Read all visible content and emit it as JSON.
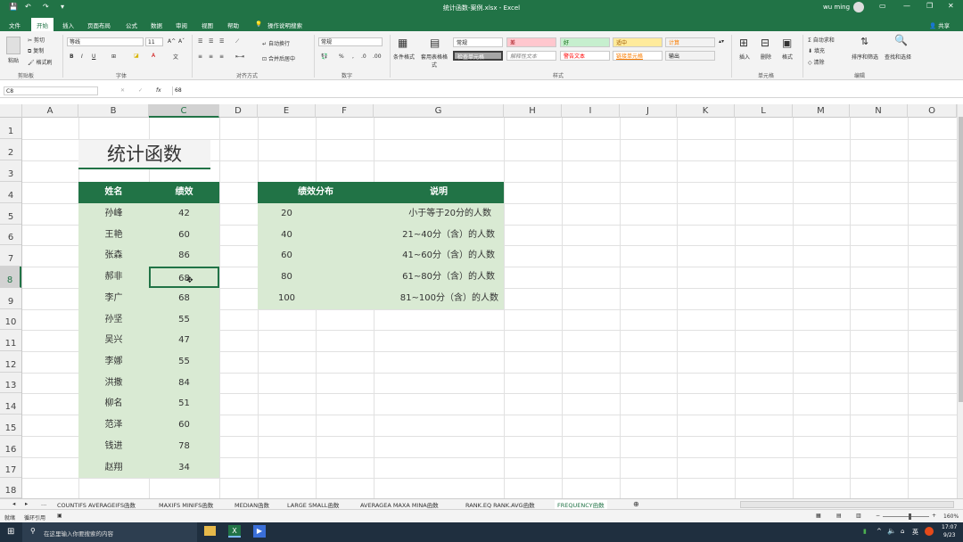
{
  "window": {
    "title": "统计函数-案例.xlsx  -  Excel",
    "user": "wu ming",
    "share": "共享"
  },
  "ribbon_tabs": [
    "文件",
    "开始",
    "插入",
    "页面布局",
    "公式",
    "数据",
    "审阅",
    "视图",
    "帮助",
    "操作说明搜索"
  ],
  "ribbon": {
    "clipboard": {
      "paste": "粘贴",
      "cut": "剪切",
      "copy": "复制",
      "format_painter": "格式刷",
      "group": "剪贴板"
    },
    "font": {
      "name": "等线",
      "size": "11",
      "group": "字体",
      "bold": "B",
      "italic": "I",
      "underline": "U"
    },
    "alignment": {
      "wrap": "自动换行",
      "merge": "合并后居中",
      "group": "对齐方式"
    },
    "number": {
      "format": "常规",
      "percent": "%",
      "group": "数字"
    },
    "styles": {
      "conditional": "条件格式",
      "table": "套用表格格式",
      "normal": "常规",
      "bad": "差",
      "good": "好",
      "neutral": "适中",
      "calc": "计算",
      "check": "检查单元格",
      "explain": "解释性文本",
      "warning": "警告文本",
      "link": "链接单元格",
      "output": "输出",
      "group": "样式"
    },
    "cells": {
      "insert": "插入",
      "delete": "删除",
      "format": "格式",
      "group": "单元格"
    },
    "editing": {
      "autosum": "自动求和",
      "fill": "填充",
      "clear": "清除",
      "sort": "排序和筛选",
      "find": "查找和选择",
      "group": "编辑"
    }
  },
  "formula_bar": {
    "name_box": "C8",
    "fx": "fx",
    "value": "68"
  },
  "columns": [
    "A",
    "B",
    "C",
    "D",
    "E",
    "F",
    "G",
    "H",
    "I",
    "J",
    "K",
    "L",
    "M",
    "N",
    "O"
  ],
  "rows": [
    "1",
    "2",
    "3",
    "4",
    "5",
    "6",
    "7",
    "8",
    "9",
    "10",
    "11",
    "12",
    "13",
    "14",
    "15",
    "16",
    "17",
    "18"
  ],
  "sheet": {
    "title": "统计函数",
    "table1_headers": [
      "姓名",
      "绩效"
    ],
    "table1": [
      [
        "孙峰",
        "42"
      ],
      [
        "王艳",
        "60"
      ],
      [
        "张森",
        "86"
      ],
      [
        "郝非",
        "68"
      ],
      [
        "李广",
        "68"
      ],
      [
        "孙坚",
        "55"
      ],
      [
        "吴兴",
        "47"
      ],
      [
        "李娜",
        "55"
      ],
      [
        "洪撒",
        "84"
      ],
      [
        "柳名",
        "51"
      ],
      [
        "范泽",
        "60"
      ],
      [
        "钱进",
        "78"
      ],
      [
        "赵翔",
        "34"
      ]
    ],
    "table2_headers": [
      "绩效分布",
      "说明"
    ],
    "table2": [
      [
        "20",
        "小于等于20分的人数"
      ],
      [
        "40",
        "21~40分（含）的人数"
      ],
      [
        "60",
        "41~60分（含）的人数"
      ],
      [
        "80",
        "61~80分（含）的人数"
      ],
      [
        "100",
        "81~100分（含）的人数"
      ]
    ]
  },
  "sheet_tabs": [
    "...",
    "COUNTIFS AVERAGEIFS函数",
    "MAXIFS MINIFS函数",
    "MEDIAN函数",
    "LARGE SMALL函数",
    "AVERAGEA MAXA MINA函数",
    "RANK.EQ RANK.AVG函数",
    "FREQUENCY函数"
  ],
  "status": {
    "ready": "就绪",
    "circular": "循环引用",
    "zoom": "160%"
  },
  "taskbar": {
    "search": "在这里输入你要搜索的内容",
    "time": "17:07",
    "date": "9/23",
    "lang": "英"
  }
}
